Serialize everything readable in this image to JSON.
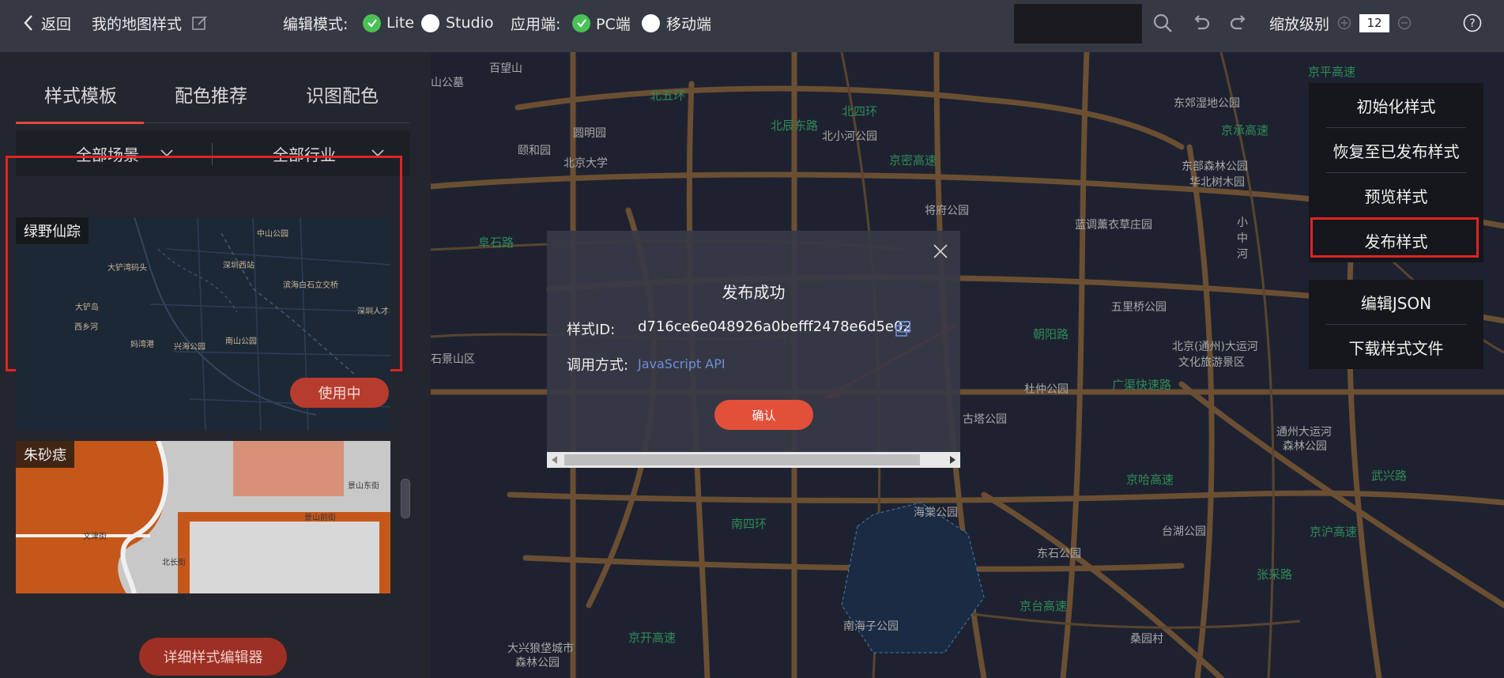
{
  "topbar": {
    "back_label": "返回",
    "map_style_name": "我的地图样式",
    "edit_mode_label": "编辑模式:",
    "mode_lite": "Lite",
    "mode_studio": "Studio",
    "app_label": "应用端:",
    "app_pc": "PC端",
    "app_mobile": "移动端",
    "zoom_label": "缩放级别",
    "zoom_value": "12"
  },
  "left": {
    "tabs": [
      "样式模板",
      "配色推荐",
      "识图配色"
    ],
    "filters": [
      "全部场景",
      "全部行业"
    ],
    "templates": [
      {
        "name": "绿野仙踪",
        "status": "使用中"
      },
      {
        "name": "朱砂痣"
      }
    ],
    "card1_places": [
      "中山公园",
      "大铲湾码头",
      "深圳西站",
      "滨海白石立交桥",
      "大铲岛",
      "深圳人才",
      "西乡河",
      "妈湾港",
      "兴海公园",
      "南山公园"
    ],
    "card2_places": [
      "文津街",
      "北长街",
      "景山东街",
      "景山前街"
    ],
    "detail_editor": "详细样式编辑器"
  },
  "map": {
    "places": [
      "百望山",
      "山公墓",
      "颐和园",
      "圆明园",
      "北京大学",
      "北小河公园",
      "将府公园",
      "东郊湿地公园",
      "东部森林公园",
      "华北树木园",
      "蓝调薰衣草庄园",
      "五里桥公园",
      "北京(通州)大运河",
      "文化旅游景区",
      "杜仲公园",
      "古塔公园",
      "海棠公园",
      "东石公园",
      "台湖公园",
      "通州大运河",
      "森林公园",
      "南海子公园",
      "大兴狼垡城市",
      "森林公园",
      "桑园村",
      "石景山区",
      "小中河",
      "京平高速"
    ],
    "roads": [
      "北五环",
      "北四环",
      "北辰东路",
      "京密高速",
      "京承高速",
      "朝阳路",
      "广渠快速路",
      "京哈高速",
      "南四环",
      "京台高速",
      "京沪高速",
      "武兴路",
      "张采路",
      "阜石路",
      "京开高速"
    ]
  },
  "right_menu": {
    "group1": [
      "初始化样式",
      "恢复至已发布样式",
      "预览样式",
      "发布样式"
    ],
    "group2": [
      "编辑JSON",
      "下载样式文件"
    ]
  },
  "dialog": {
    "title": "发布成功",
    "id_label": "样式ID:",
    "id_value": "d716ce6e048926a0befff2478e6d5e02",
    "call_label": "调用方式:",
    "call_value": "JavaScript API",
    "confirm": "确认"
  },
  "colors": {
    "accent_red": "#e02424",
    "button_red": "#e3503a",
    "check_green": "#4ac154",
    "road_brown": "#6b4f33"
  }
}
